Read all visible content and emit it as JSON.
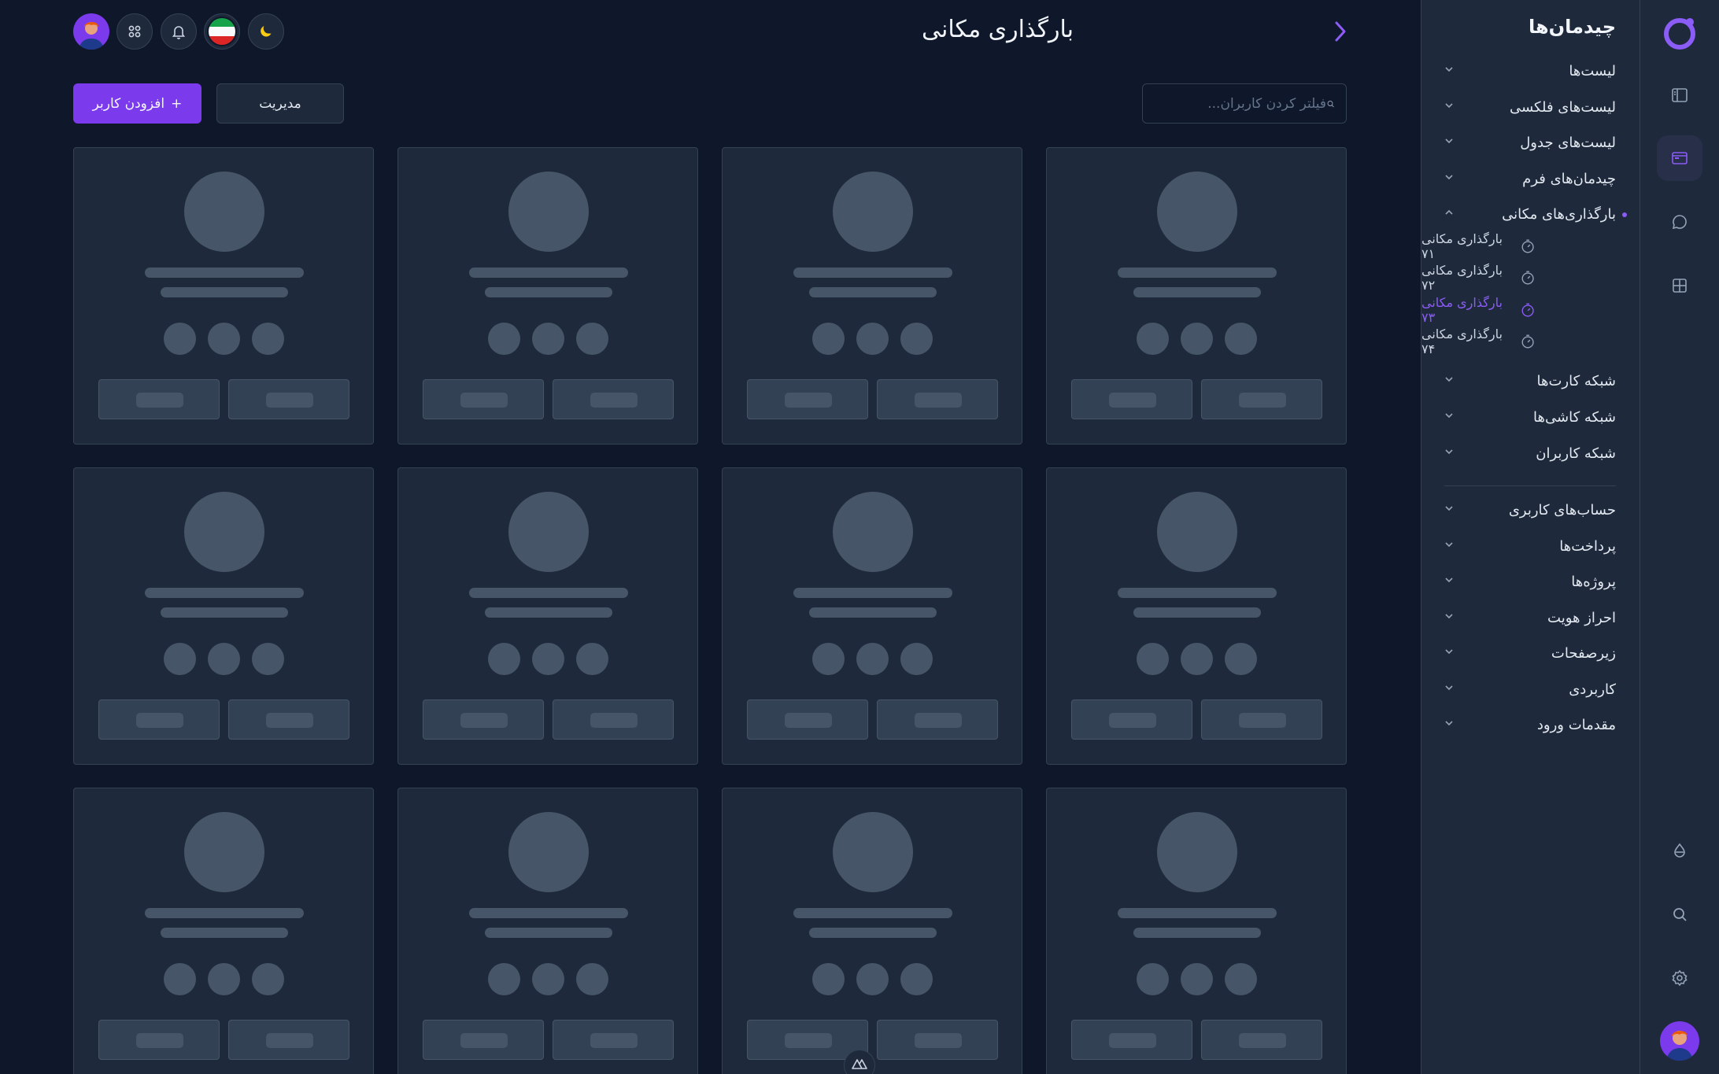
{
  "header": {
    "title": "بارگذاری مکانی",
    "search_placeholder": "فیلتر کردن کاربران...",
    "manage_label": "مدیریت",
    "add_user_label": "افزودن کاربر",
    "add_icon_glyph": "+"
  },
  "topbar": {
    "icons": [
      "apps-grid-icon",
      "bell-icon",
      "language-flag-icon",
      "moon-icon"
    ]
  },
  "panel": {
    "title": "چیدمان‌ها",
    "items": [
      {
        "label": "لیست‌ها"
      },
      {
        "label": "لیست‌های فلکسی"
      },
      {
        "label": "لیست‌های جدول"
      },
      {
        "label": "چیدمان‌های فرم"
      },
      {
        "label": "بارگذاری‌های مکانی"
      },
      {
        "label": "شبکه کارت‌ها"
      },
      {
        "label": "شبکه کاشی‌ها"
      },
      {
        "label": "شبکه کاربران"
      },
      {
        "label": "حساب‌های کاربری"
      },
      {
        "label": "پرداخت‌ها"
      },
      {
        "label": "پروژه‌ها"
      },
      {
        "label": "احراز هویت"
      },
      {
        "label": "زیرصفحات"
      },
      {
        "label": "کاربردی"
      },
      {
        "label": "مقدمات ورود"
      }
    ],
    "sub_items": [
      {
        "label": "بارگذاری مکانی ۷۱"
      },
      {
        "label": "بارگذاری مکانی ۷۲"
      },
      {
        "label": "بارگذاری مکانی ۷۳"
      },
      {
        "label": "بارگذاری مکانی ۷۴"
      }
    ]
  },
  "colors": {
    "accent": "#7c3aed",
    "background": "#0f172a",
    "surface": "#1e293b",
    "skeleton": "#475569"
  }
}
